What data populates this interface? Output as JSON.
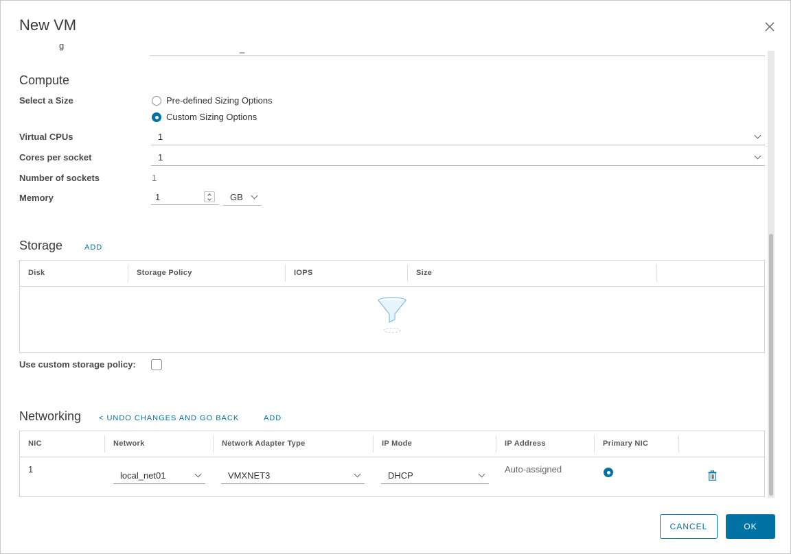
{
  "dialog": {
    "title": "New VM"
  },
  "top_field": {
    "label_fragment": "g",
    "value_fragment": "_"
  },
  "compute": {
    "title": "Compute",
    "select_size_label": "Select a Size",
    "size_options": [
      "Pre-defined Sizing Options",
      "Custom Sizing Options"
    ],
    "selected_size": "Custom Sizing Options",
    "virtual_cpus_label": "Virtual CPUs",
    "virtual_cpus_value": "1",
    "cores_label": "Cores per socket",
    "cores_value": "1",
    "sockets_label": "Number of sockets",
    "sockets_value": "1",
    "memory_label": "Memory",
    "memory_value": "1",
    "memory_unit": "GB"
  },
  "storage": {
    "title": "Storage",
    "add_label": "ADD",
    "columns": [
      "Disk",
      "Storage Policy",
      "IOPS",
      "Size"
    ],
    "empty_icon": "funnel-icon",
    "custom_policy_label": "Use custom storage policy:",
    "custom_policy_checked": false
  },
  "networking": {
    "title": "Networking",
    "undo_label": "< UNDO CHANGES AND GO BACK",
    "add_label": "ADD",
    "columns": [
      "NIC",
      "Network",
      "Network Adapter Type",
      "IP Mode",
      "IP Address",
      "Primary NIC"
    ],
    "rows": [
      {
        "nic": "1",
        "network": "local_net01",
        "adapter_type": "VMXNET3",
        "ip_mode": "DHCP",
        "ip_address": "Auto-assigned",
        "primary": true
      }
    ],
    "delete_icon": "trash-icon"
  },
  "footer": {
    "cancel_label": "CANCEL",
    "ok_label": "OK"
  },
  "colors": {
    "accent": "#0072a3",
    "border": "#cfcfcf",
    "text": "#313131"
  },
  "icons": {
    "close": "close-icon",
    "chevron": "chevron-down-icon"
  }
}
